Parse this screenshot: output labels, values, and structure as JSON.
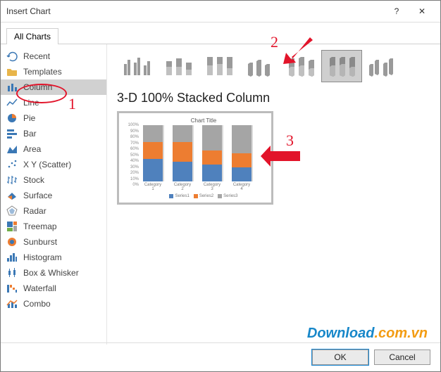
{
  "window": {
    "title": "Insert Chart"
  },
  "tabs": {
    "all": "All Charts"
  },
  "sidebar": {
    "items": [
      {
        "label": "Recent"
      },
      {
        "label": "Templates"
      },
      {
        "label": "Column"
      },
      {
        "label": "Line"
      },
      {
        "label": "Pie"
      },
      {
        "label": "Bar"
      },
      {
        "label": "Area"
      },
      {
        "label": "X Y (Scatter)"
      },
      {
        "label": "Stock"
      },
      {
        "label": "Surface"
      },
      {
        "label": "Radar"
      },
      {
        "label": "Treemap"
      },
      {
        "label": "Sunburst"
      },
      {
        "label": "Histogram"
      },
      {
        "label": "Box & Whisker"
      },
      {
        "label": "Waterfall"
      },
      {
        "label": "Combo"
      }
    ]
  },
  "subtype_title": "3-D 100% Stacked Column",
  "subtypes": [
    {
      "name": "clustered-column"
    },
    {
      "name": "stacked-column"
    },
    {
      "name": "100-stacked-column"
    },
    {
      "name": "3d-clustered-column"
    },
    {
      "name": "3d-stacked-column"
    },
    {
      "name": "3d-100-stacked-column",
      "selected": true
    },
    {
      "name": "3d-column"
    }
  ],
  "chart_data": {
    "type": "bar",
    "stacked": true,
    "title": "Chart Title",
    "categories": [
      "Category 1",
      "Category 2",
      "Category 3",
      "Category 4"
    ],
    "series": [
      {
        "name": "Series1",
        "values": [
          40,
          35,
          30,
          25
        ],
        "color": "#4f81bd"
      },
      {
        "name": "Series2",
        "values": [
          30,
          35,
          25,
          25
        ],
        "color": "#ed7d31"
      },
      {
        "name": "Series3",
        "values": [
          30,
          30,
          45,
          50
        ],
        "color": "#a5a5a5"
      }
    ],
    "ylabel": "",
    "xlabel": "",
    "ylim": [
      0,
      100
    ],
    "yticks": [
      "100%",
      "90%",
      "80%",
      "70%",
      "60%",
      "50%",
      "40%",
      "30%",
      "20%",
      "10%",
      "0%"
    ]
  },
  "footer": {
    "ok": "OK",
    "cancel": "Cancel"
  },
  "annotations": {
    "n1": "1",
    "n2": "2",
    "n3": "3"
  },
  "watermark": {
    "lead": "Download",
    "tail": ".com.vn"
  }
}
